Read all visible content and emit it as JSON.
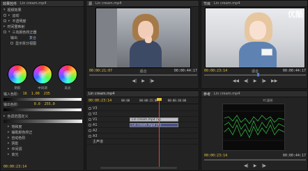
{
  "watermark": "优酷",
  "effect_controls": {
    "tabs": [
      "效果控件",
      "Lin cream.mp4"
    ],
    "rows": [
      "视频效果",
      "运动",
      "不透明度",
      "时间重映射",
      "三向颜色校正器",
      "输出",
      "显示拆分视图"
    ],
    "output_value": "复合",
    "wheels": [
      "阴影",
      "中间调",
      "高光"
    ],
    "input_levels_label": "输入色阶:",
    "input_levels": [
      "16",
      "1.00",
      "235"
    ],
    "output_levels_label": "输出色阶:",
    "output_levels": [
      "0.0",
      "255.0"
    ],
    "sub_rows": [
      "色调范围定义",
      "饱和度",
      "辅助颜色校正",
      "自动色阶",
      "阴影",
      "中间调",
      "高光"
    ],
    "timecode": "00:00:23:14"
  },
  "source_monitor": {
    "tabs": [
      "源",
      "Lin cream.mp4"
    ],
    "timecode_left": "00:00:21:07",
    "fit": "适合",
    "timecode_right": "00:00:44:17"
  },
  "program_monitor": {
    "tabs": [
      "节目",
      "Lin cream.mp4"
    ],
    "timecode_left": "00:00:23:14",
    "fit": "适合",
    "timecode_right": "00:00:44:17",
    "transport": [
      "◀◀",
      "◀|",
      "▶",
      "|▶",
      "▶▶"
    ]
  },
  "timeline": {
    "tabs": [
      "Lin cream.mp4"
    ],
    "timecode": "00:00:23:14",
    "ruler": [
      "00:00",
      "00:00:15:00",
      "00:00:30:00"
    ],
    "tracks": [
      "V3",
      "V2",
      "V1",
      "A1",
      "A2",
      "A3"
    ],
    "master": "主声道",
    "clips": [
      "Lin cream.mp4 [V]",
      "Lin cream.mp4 [A]"
    ]
  },
  "scopes": {
    "tabs": [
      "参考",
      "Lin cream.mp4"
    ],
    "timecode_left": "00:00:23:14",
    "timecode_right": "00:00:44:17",
    "label": "YC波形"
  },
  "colors": {
    "accent_timecode": "#e8c33a",
    "playhead": "#e0453a",
    "waveform": "#38d04a"
  }
}
